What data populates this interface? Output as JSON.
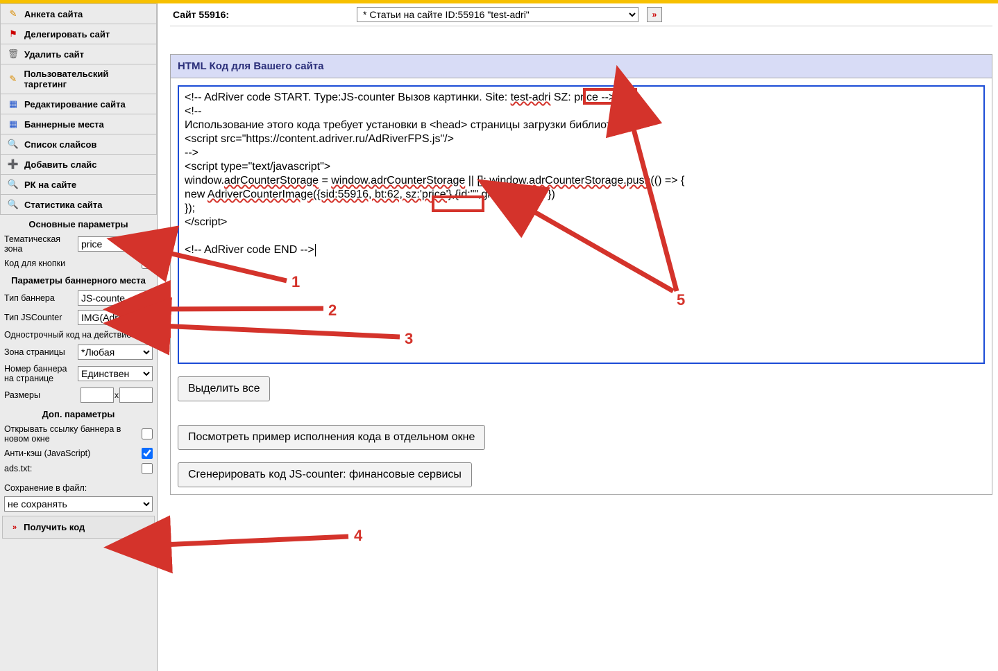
{
  "colors": {
    "accent_red": "#d4332b",
    "panel_head": "#d8dcf6"
  },
  "sidebar": {
    "menu": [
      {
        "icon": "✎",
        "color": "#d88b00",
        "label": "Анкета сайта",
        "name": "menu-site-profile"
      },
      {
        "icon": "⚑",
        "color": "#c00",
        "label": "Делегировать сайт",
        "name": "menu-delegate-site"
      },
      {
        "icon": "🗑",
        "color": "#666",
        "label": "Удалить сайт",
        "name": "menu-delete-site"
      },
      {
        "icon": "✎",
        "color": "#d88b00",
        "label": "Пользовательский таргетинг",
        "name": "menu-user-targeting"
      },
      {
        "icon": "▦",
        "color": "#2255cc",
        "label": "Редактирование сайта",
        "name": "menu-edit-site"
      },
      {
        "icon": "▦",
        "color": "#2255cc",
        "label": "Баннерные места",
        "name": "menu-banner-places"
      },
      {
        "icon": "🔍",
        "color": "#2255cc",
        "label": "Список слайсов",
        "name": "menu-slice-list"
      },
      {
        "icon": "➕",
        "color": "#2a8a2a",
        "label": "Добавить слайс",
        "name": "menu-add-slice"
      },
      {
        "icon": "🔍",
        "color": "#2255cc",
        "label": "РК на сайте",
        "name": "menu-campaigns"
      },
      {
        "icon": "🔍",
        "color": "#2255cc",
        "label": "Статистика сайта",
        "name": "menu-stats"
      }
    ],
    "section_main": "Основные параметры",
    "theme_zone_label": "Тематическая зона",
    "theme_zone_value": "price",
    "button_code_label": "Код для кнопки",
    "section_banner": "Параметры баннерного места",
    "banner_type_label": "Тип баннера",
    "banner_type_value": "JS-counte",
    "jscounter_type_label": "Тип JSCounter",
    "jscounter_type_value": "IMG(Adriv",
    "oneline_label": "Однострочный код на действие",
    "page_zone_label": "Зона страницы",
    "page_zone_value": "*Любая",
    "banner_num_label": "Номер баннера на странице",
    "banner_num_value": "Единствен",
    "sizes_label": "Размеры",
    "section_extra": "Доп. параметры",
    "open_new_label": "Открывать ссылку баннера в новом окне",
    "anticache_label": "Анти-кэш (JavaScript)",
    "adstxt_label": "ads.txt:",
    "save_file_label": "Сохранение в файл:",
    "save_file_value": "не сохранять",
    "get_code_label": "Получить код"
  },
  "top": {
    "site_label": "Сайт 55916:",
    "select_value": "* Статьи на сайте ID:55916   \"test-adri\""
  },
  "panel": {
    "title": "HTML Код для Вашего сайта",
    "select_all": "Выделить все",
    "preview": "Посмотреть пример исполнения кода в отдельном окне",
    "generate": "Сгенерировать код JS-counter: финансовые сервисы"
  },
  "code": {
    "l1a": "<!--  AdRiver code START. Type:JS-counter Вызов картинки. Site: ",
    "l1b": "test-adri",
    "l1c": " SZ: price",
    "l1d": " -->",
    "l2": "<!--",
    "l3": "Использование этого кода требует установки в <head> страницы загрузки библиотеки",
    "l4": "<script src=\"https://content.adriver.ru/AdRiverFPS.js\"/>",
    "l5": "-->",
    "l6": "<script type=\"text/javascript\">",
    "l7a": "window.",
    "l7b": "adrCounterStorage",
    "l7c": " = ",
    "l7d": "window.adrCounterStorage",
    "l7e": " || []; window.",
    "l7f": "adrCounterStorage.push",
    "l7g": "(() => {",
    "l8a": "  new ",
    "l8b": "AdriverCounterImage({sid:55916, bt:62, sz:'price'}",
    "l8c": ",{id:\"\",gid1:\"\",yid1:\"\"})",
    "l9": "});",
    "l10": "</script>",
    "l12": "<!--  AdRiver code END  -->"
  },
  "anno": {
    "n1": "1",
    "n2": "2",
    "n3": "3",
    "n4": "4",
    "n5": "5"
  }
}
